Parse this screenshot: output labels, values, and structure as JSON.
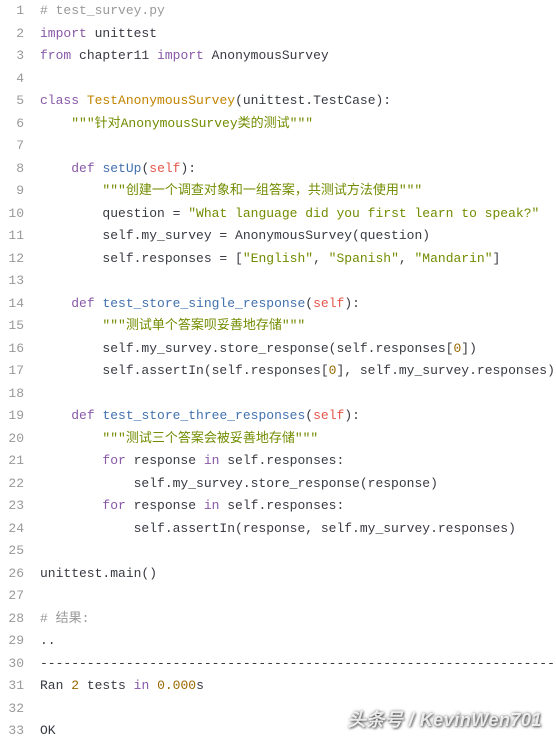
{
  "lines": [
    {
      "n": "1",
      "segs": [
        {
          "cls": "comment",
          "t": "# test_survey.py"
        }
      ]
    },
    {
      "n": "2",
      "segs": [
        {
          "cls": "keyword",
          "t": "import"
        },
        {
          "cls": "plain",
          "t": " unittest"
        }
      ]
    },
    {
      "n": "3",
      "segs": [
        {
          "cls": "keyword",
          "t": "from"
        },
        {
          "cls": "plain",
          "t": " chapter11 "
        },
        {
          "cls": "keyword",
          "t": "import"
        },
        {
          "cls": "plain",
          "t": " AnonymousSurvey"
        }
      ]
    },
    {
      "n": "4",
      "segs": []
    },
    {
      "n": "5",
      "segs": [
        {
          "cls": "keyword",
          "t": "class"
        },
        {
          "cls": "plain",
          "t": " "
        },
        {
          "cls": "classname",
          "t": "TestAnonymousSurvey"
        },
        {
          "cls": "punct",
          "t": "("
        },
        {
          "cls": "plain",
          "t": "unittest.TestCase"
        },
        {
          "cls": "punct",
          "t": "):"
        }
      ]
    },
    {
      "n": "6",
      "segs": [
        {
          "cls": "plain",
          "t": "    "
        },
        {
          "cls": "string",
          "t": "\"\"\"针对AnonymousSurvey类的测试\"\"\""
        }
      ]
    },
    {
      "n": "7",
      "segs": []
    },
    {
      "n": "8",
      "segs": [
        {
          "cls": "plain",
          "t": "    "
        },
        {
          "cls": "keyword",
          "t": "def"
        },
        {
          "cls": "plain",
          "t": " "
        },
        {
          "cls": "funcname",
          "t": "setUp"
        },
        {
          "cls": "punct",
          "t": "("
        },
        {
          "cls": "self",
          "t": "self"
        },
        {
          "cls": "punct",
          "t": "):"
        }
      ]
    },
    {
      "n": "9",
      "segs": [
        {
          "cls": "plain",
          "t": "        "
        },
        {
          "cls": "string",
          "t": "\"\"\"创建一个调查对象和一组答案，共测试方法使用\"\"\""
        }
      ]
    },
    {
      "n": "10",
      "segs": [
        {
          "cls": "plain",
          "t": "        question = "
        },
        {
          "cls": "string",
          "t": "\"What language did you first learn to speak?\""
        }
      ]
    },
    {
      "n": "11",
      "segs": [
        {
          "cls": "plain",
          "t": "        self.my_survey = AnonymousSurvey(question)"
        }
      ]
    },
    {
      "n": "12",
      "segs": [
        {
          "cls": "plain",
          "t": "        self.responses = ["
        },
        {
          "cls": "string",
          "t": "\"English\""
        },
        {
          "cls": "plain",
          "t": ", "
        },
        {
          "cls": "string",
          "t": "\"Spanish\""
        },
        {
          "cls": "plain",
          "t": ", "
        },
        {
          "cls": "string",
          "t": "\"Mandarin\""
        },
        {
          "cls": "plain",
          "t": "]"
        }
      ]
    },
    {
      "n": "13",
      "segs": []
    },
    {
      "n": "14",
      "segs": [
        {
          "cls": "plain",
          "t": "    "
        },
        {
          "cls": "keyword",
          "t": "def"
        },
        {
          "cls": "plain",
          "t": " "
        },
        {
          "cls": "funcname",
          "t": "test_store_single_response"
        },
        {
          "cls": "punct",
          "t": "("
        },
        {
          "cls": "self",
          "t": "self"
        },
        {
          "cls": "punct",
          "t": "):"
        }
      ]
    },
    {
      "n": "15",
      "segs": [
        {
          "cls": "plain",
          "t": "        "
        },
        {
          "cls": "string",
          "t": "\"\"\"测试单个答案呗妥善地存储\"\"\""
        }
      ]
    },
    {
      "n": "16",
      "segs": [
        {
          "cls": "plain",
          "t": "        self.my_survey.store_response(self.responses["
        },
        {
          "cls": "number",
          "t": "0"
        },
        {
          "cls": "plain",
          "t": "])"
        }
      ]
    },
    {
      "n": "17",
      "segs": [
        {
          "cls": "plain",
          "t": "        self.assertIn(self.responses["
        },
        {
          "cls": "number",
          "t": "0"
        },
        {
          "cls": "plain",
          "t": "], self.my_survey.responses)"
        }
      ]
    },
    {
      "n": "18",
      "segs": []
    },
    {
      "n": "19",
      "segs": [
        {
          "cls": "plain",
          "t": "    "
        },
        {
          "cls": "keyword",
          "t": "def"
        },
        {
          "cls": "plain",
          "t": " "
        },
        {
          "cls": "funcname",
          "t": "test_store_three_responses"
        },
        {
          "cls": "punct",
          "t": "("
        },
        {
          "cls": "self",
          "t": "self"
        },
        {
          "cls": "punct",
          "t": "):"
        }
      ]
    },
    {
      "n": "20",
      "segs": [
        {
          "cls": "plain",
          "t": "        "
        },
        {
          "cls": "string",
          "t": "\"\"\"测试三个答案会被妥善地存储\"\"\""
        }
      ]
    },
    {
      "n": "21",
      "segs": [
        {
          "cls": "plain",
          "t": "        "
        },
        {
          "cls": "keyword",
          "t": "for"
        },
        {
          "cls": "plain",
          "t": " response "
        },
        {
          "cls": "keyword",
          "t": "in"
        },
        {
          "cls": "plain",
          "t": " self.responses:"
        }
      ]
    },
    {
      "n": "22",
      "segs": [
        {
          "cls": "plain",
          "t": "            self.my_survey.store_response(response)"
        }
      ]
    },
    {
      "n": "23",
      "segs": [
        {
          "cls": "plain",
          "t": "        "
        },
        {
          "cls": "keyword",
          "t": "for"
        },
        {
          "cls": "plain",
          "t": " response "
        },
        {
          "cls": "keyword",
          "t": "in"
        },
        {
          "cls": "plain",
          "t": " self.responses:"
        }
      ]
    },
    {
      "n": "24",
      "segs": [
        {
          "cls": "plain",
          "t": "            self.assertIn(response, self.my_survey.responses)"
        }
      ]
    },
    {
      "n": "25",
      "segs": []
    },
    {
      "n": "26",
      "segs": [
        {
          "cls": "plain",
          "t": "unittest.main()"
        }
      ]
    },
    {
      "n": "27",
      "segs": []
    },
    {
      "n": "28",
      "segs": [
        {
          "cls": "comment",
          "t": "# 结果:"
        }
      ]
    },
    {
      "n": "29",
      "segs": [
        {
          "cls": "plain",
          "t": ".."
        }
      ]
    },
    {
      "n": "30",
      "segs": [
        {
          "cls": "plain",
          "t": "----------------------------------------------------------------------"
        }
      ]
    },
    {
      "n": "31",
      "segs": [
        {
          "cls": "plain",
          "t": "Ran "
        },
        {
          "cls": "number",
          "t": "2"
        },
        {
          "cls": "plain",
          "t": " tests "
        },
        {
          "cls": "keyword",
          "t": "in"
        },
        {
          "cls": "plain",
          "t": " "
        },
        {
          "cls": "number",
          "t": "0.000"
        },
        {
          "cls": "plain",
          "t": "s"
        }
      ]
    },
    {
      "n": "32",
      "segs": []
    },
    {
      "n": "33",
      "segs": [
        {
          "cls": "plain",
          "t": "OK"
        }
      ]
    }
  ],
  "watermark": "头条号 / KevinWen701"
}
